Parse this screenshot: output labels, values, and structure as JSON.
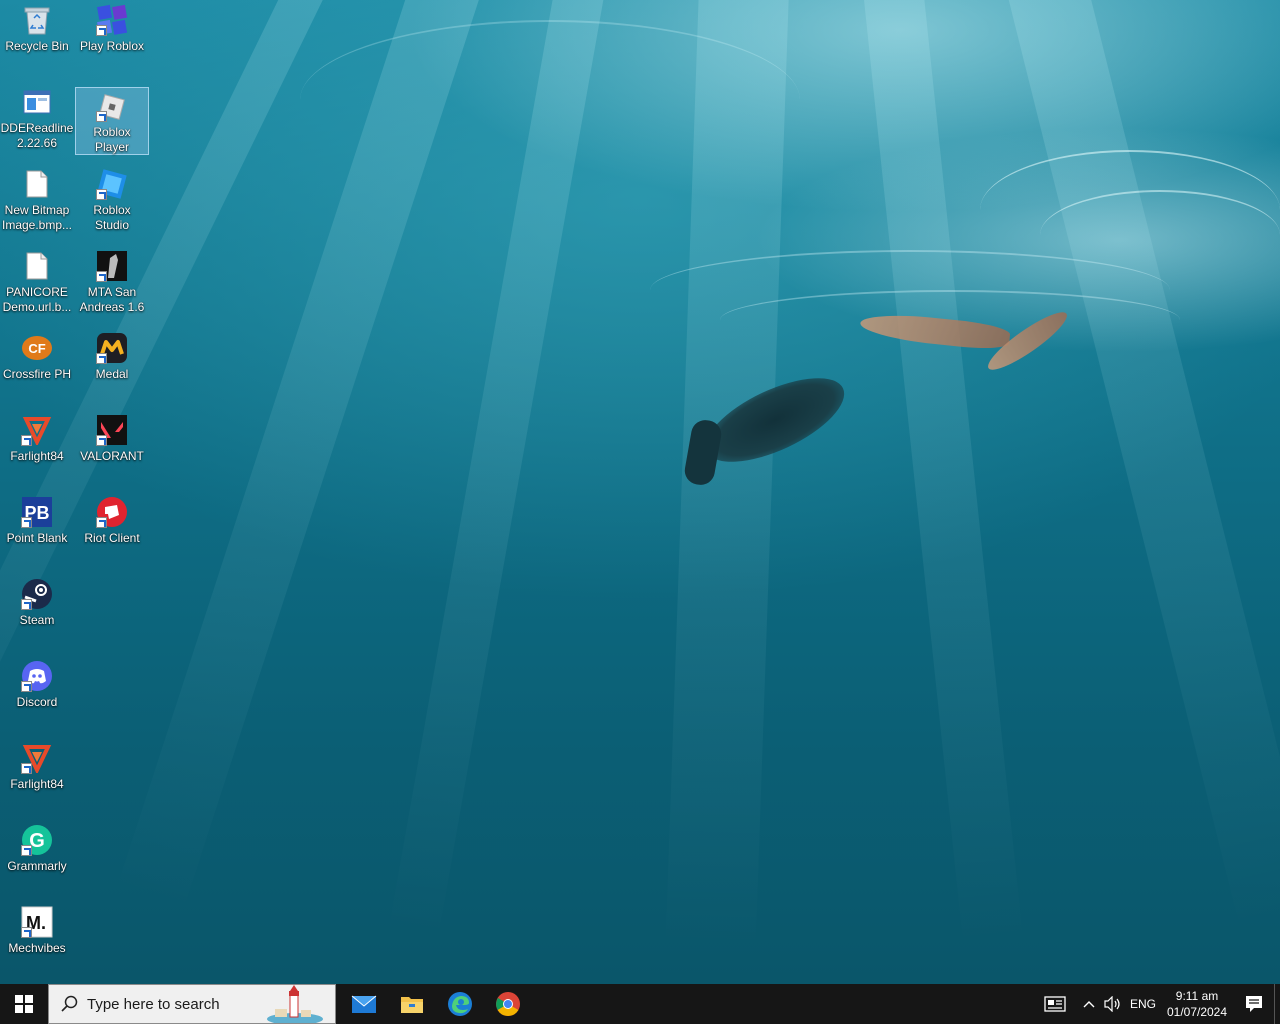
{
  "desktop": {
    "icons": [
      {
        "label": "Recycle Bin",
        "icon": "recycle-bin-icon"
      },
      {
        "label": "Play Roblox",
        "icon": "roblox-icon"
      },
      {
        "label": "DDEReadline 2.22.66",
        "icon": "window-app-icon"
      },
      {
        "label": "Roblox Player",
        "icon": "roblox-player-icon"
      },
      {
        "label": "New Bitmap Image.bmp...",
        "icon": "file-icon"
      },
      {
        "label": "Roblox Studio",
        "icon": "roblox-studio-icon"
      },
      {
        "label": "PANICORE Demo.url.b...",
        "icon": "file-icon"
      },
      {
        "label": "MTA San Andreas 1.6",
        "icon": "mta-icon"
      },
      {
        "label": "Crossfire PH",
        "icon": "crossfire-icon"
      },
      {
        "label": "Medal",
        "icon": "medal-icon"
      },
      {
        "label": "Farlight84",
        "icon": "farlight-icon"
      },
      {
        "label": "VALORANT",
        "icon": "valorant-icon"
      },
      {
        "label": "Point Blank",
        "icon": "point-blank-icon"
      },
      {
        "label": "Riot Client",
        "icon": "riot-client-icon"
      },
      {
        "label": "Steam",
        "icon": "steam-icon"
      },
      {
        "label": "Discord",
        "icon": "discord-icon"
      },
      {
        "label": "Farlight84",
        "icon": "farlight-icon"
      },
      {
        "label": "Grammarly",
        "icon": "grammarly-icon"
      },
      {
        "label": "Mechvibes",
        "icon": "mechvibes-icon"
      }
    ],
    "selected": "Roblox Player"
  },
  "taskbar": {
    "search_placeholder": "Type here to search",
    "pinned": [
      "mail-icon",
      "file-explorer-icon",
      "edge-icon",
      "chrome-icon"
    ],
    "tray": {
      "language": "ENG",
      "time": "9:11 am",
      "date": "01/07/2024"
    }
  },
  "colors": {
    "taskbar": "#161616",
    "search_bg": "#f0f0f0",
    "selection": "#99c9ef",
    "water": "#0e6c84"
  }
}
